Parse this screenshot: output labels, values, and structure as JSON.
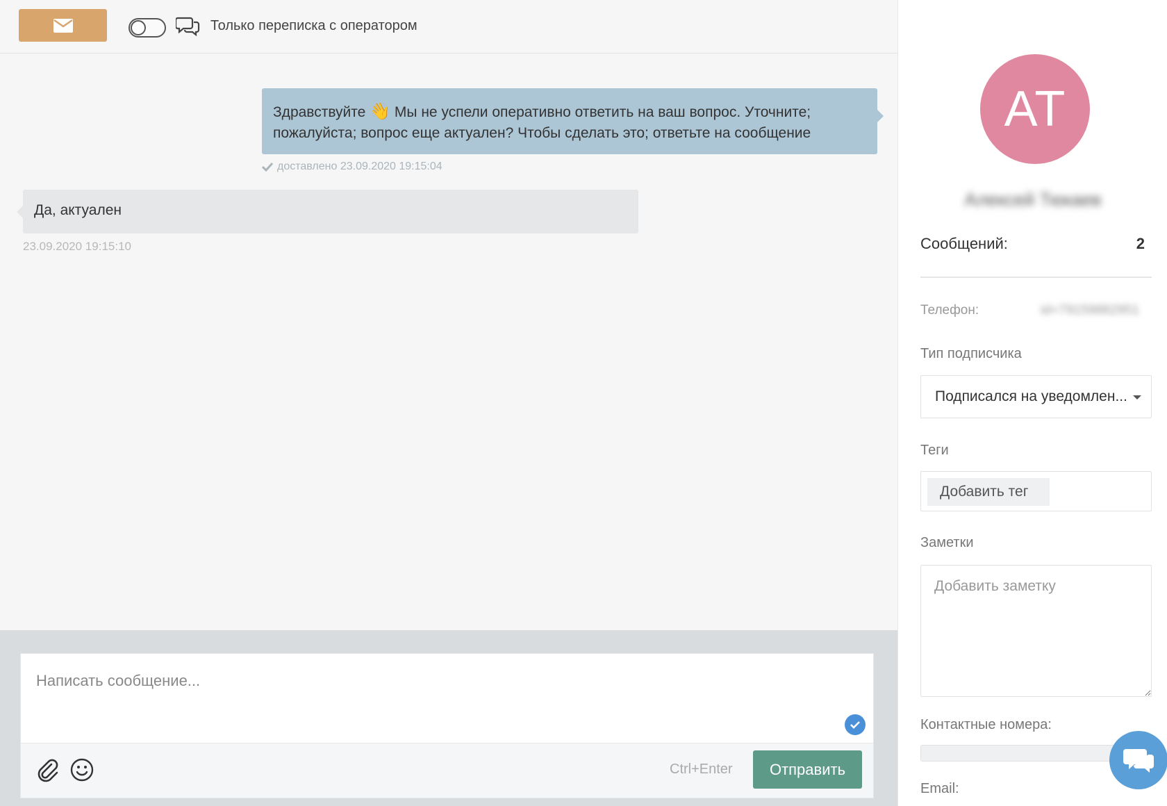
{
  "header": {
    "mail_icon": "envelope-icon",
    "toggle_state": "off",
    "chat_icon": "chat-bubbles-icon",
    "operator_only_label": "Только переписка с оператором"
  },
  "messages": [
    {
      "direction": "outgoing",
      "text_part1": "Здравствуйте",
      "emoji": "👋",
      "text_part2": "Мы не успели оперативно ответить на ваш вопрос. Уточните; пожалуйста; вопрос еще актуален? Чтобы сделать это; ответьте на сообщение",
      "status": "доставлено 23.09.2020 19:15:04"
    },
    {
      "direction": "incoming",
      "text": "Да, актуален",
      "time": "23.09.2020 19:15:10"
    }
  ],
  "composer": {
    "placeholder": "Написать сообщение...",
    "shortcut": "Ctrl+Enter",
    "send_label": "Отправить",
    "attach_icon": "paperclip-icon",
    "emoji_icon": "smiley-icon",
    "check_icon": "check-badge-icon"
  },
  "sidebar": {
    "avatar_initials": "AT",
    "avatar_color": "#e0889f",
    "user_name": "Алексей Тюкаев",
    "messages_label": "Сообщений:",
    "messages_count": "2",
    "phone_label": "Телефон:",
    "phone_value": "id+79159882951",
    "subscriber_type_label": "Тип подписчика",
    "subscriber_type_value": "Подписался на уведомлен...",
    "tags_label": "Теги",
    "tags_placeholder": "Добавить тег",
    "notes_label": "Заметки",
    "notes_placeholder": "Добавить заметку",
    "contacts_label": "Контактные номера:",
    "email_label": "Email:"
  },
  "colors": {
    "accent_mail": "#d8a66c",
    "send_button": "#5d9a87",
    "outgoing_bubble": "#adc6d6",
    "incoming_bubble": "#e6e7e9",
    "widget": "#5b9fd8"
  }
}
